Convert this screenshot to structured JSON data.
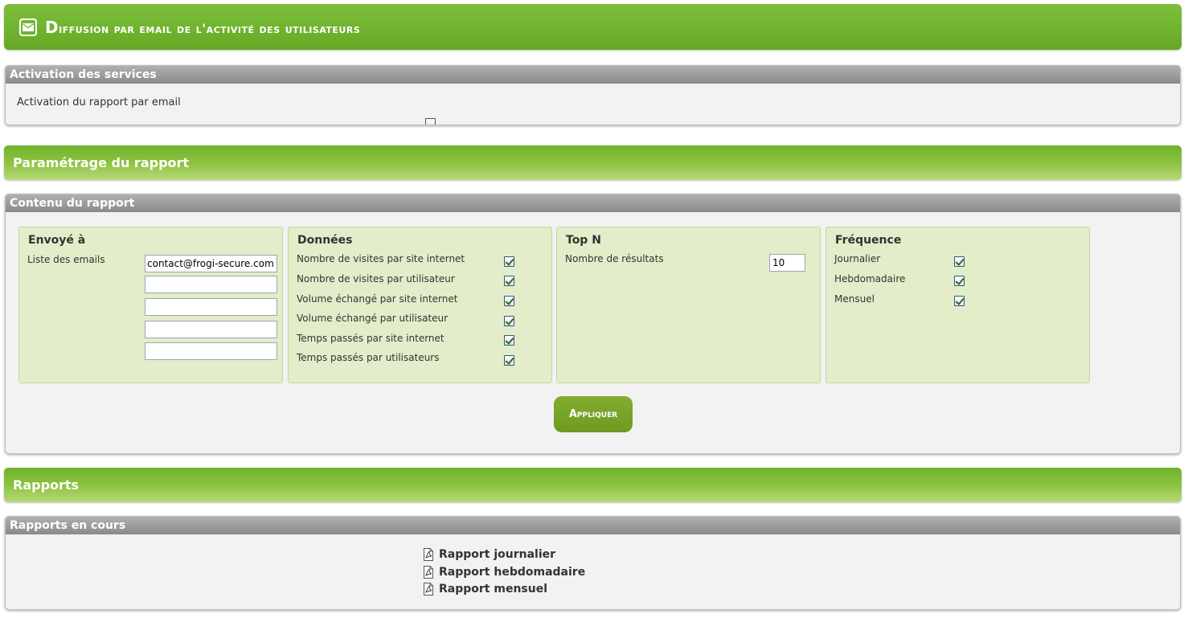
{
  "page": {
    "title": "Diffusion par email de l'activité des utilisateurs",
    "title_first": "D",
    "title_rest": "iffusion par email de l'activité des utilisateurs"
  },
  "activation": {
    "header": "Activation des services",
    "label": "Activation du rapport par email",
    "checked": false
  },
  "parametrage": {
    "title": "Paramétrage du rapport"
  },
  "contenu": {
    "header": "Contenu du rapport",
    "envoye": {
      "title": "Envoyé à",
      "label": "Liste des emails",
      "emails": [
        "contact@frogi-secure.com",
        "",
        "",
        "",
        ""
      ]
    },
    "donnees": {
      "title": "Données",
      "items": [
        {
          "label": "Nombre de visites par site internet",
          "checked": true
        },
        {
          "label": "Nombre de visites par utilisateur",
          "checked": true
        },
        {
          "label": "Volume échangé par site internet",
          "checked": true
        },
        {
          "label": "Volume échangé par utilisateur",
          "checked": true
        },
        {
          "label": "Temps passés par site internet",
          "checked": true
        },
        {
          "label": "Temps passés par utilisateurs",
          "checked": true
        }
      ]
    },
    "topn": {
      "title": "Top N",
      "label": "Nombre de résultats",
      "value": "10"
    },
    "frequence": {
      "title": "Fréquence",
      "items": [
        {
          "label": "Journalier",
          "checked": true
        },
        {
          "label": "Hebdomadaire",
          "checked": true
        },
        {
          "label": "Mensuel",
          "checked": true
        }
      ]
    },
    "apply_label": "Appliquer"
  },
  "rapports": {
    "title": "Rapports",
    "header": "Rapports en cours",
    "links": [
      "Rapport journalier",
      "Rapport hebdomadaire",
      "Rapport mensuel"
    ]
  },
  "colors": {
    "brand_green": "#6fb22d",
    "panel_header_grey": "#8a8a8a",
    "subbox_bg": "#e3edc9",
    "button_green": "#76a126"
  },
  "icons": {
    "title": "envelope-icon",
    "report": "pdf-icon"
  }
}
